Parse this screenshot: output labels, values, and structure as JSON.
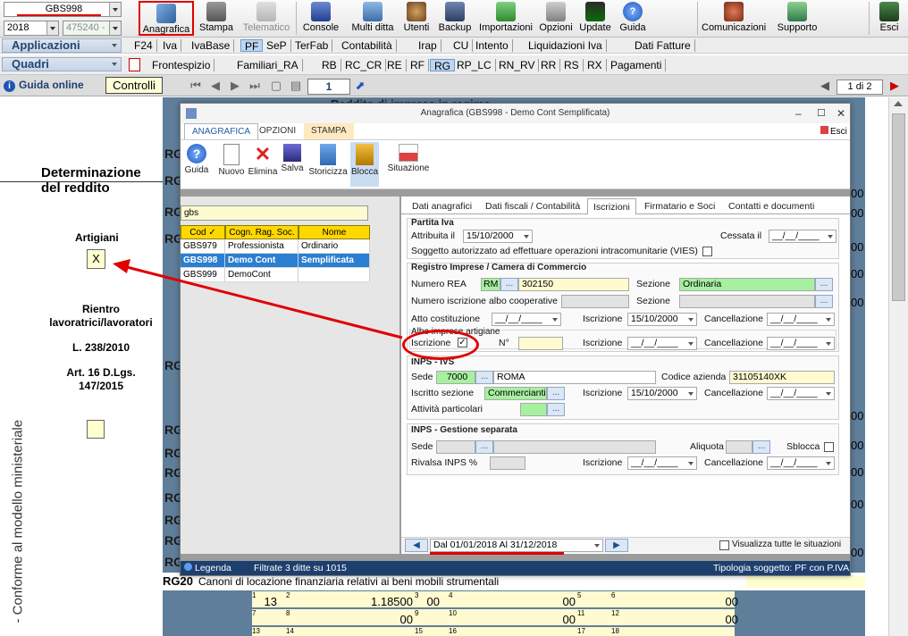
{
  "toolbar": {
    "company_code": "GBS998",
    "year": "2018",
    "company_number": "475240 -",
    "buttons": [
      {
        "label": "Anagrafica",
        "icon": "anagrafica-icon"
      },
      {
        "label": "Stampa",
        "icon": "printer-icon"
      },
      {
        "label": "Telematico",
        "icon": "telematico-icon"
      },
      {
        "label": "Console",
        "icon": "console-icon"
      },
      {
        "label": "Multi ditta",
        "icon": "multi-ditta-icon"
      },
      {
        "label": "Utenti",
        "icon": "users-icon"
      },
      {
        "label": "Backup",
        "icon": "backup-icon"
      },
      {
        "label": "Importazioni",
        "icon": "import-icon"
      },
      {
        "label": "Opzioni",
        "icon": "wrench-icon"
      },
      {
        "label": "Update",
        "icon": "update-icon"
      },
      {
        "label": "Guida",
        "icon": "help-icon"
      },
      {
        "label": "Comunicazioni",
        "icon": "comunicazioni-icon"
      },
      {
        "label": "Supporto",
        "icon": "supporto-icon"
      },
      {
        "label": "Esci",
        "icon": "exit-icon"
      }
    ]
  },
  "menu": {
    "applicazioni_label": "Applicazioni",
    "quadri_label": "Quadri",
    "applicazioni_items": [
      "F24",
      "Iva",
      "IvaBase",
      "PF",
      "SeP",
      "TerFab",
      "Contabilità",
      "Irap",
      "CU",
      "Intento",
      "Liquidazioni Iva",
      "Dati Fatture"
    ],
    "quadri_items": [
      "Frontespizio",
      "Familiari_RA",
      "RB",
      "RC_CR",
      "RE",
      "RF",
      "RG",
      "RP_LC",
      "RN_RV",
      "RR",
      "RS",
      "RX",
      "Pagamenti"
    ]
  },
  "nav": {
    "guida_online": "Guida online",
    "controlli": "Controlli",
    "page": "1",
    "page_of": "1 di 2"
  },
  "document": {
    "heading_partial": "Reddito di impresa in regime",
    "side_title_1": "Determinazione",
    "side_title_2": "del reddito",
    "artigiani": "Artigiani",
    "artigiani_mark": "X",
    "rientro_1": "Rientro",
    "rientro_2": "lavoratrici/lavoratori",
    "legge": "L. 238/2010",
    "art_1": "Art. 16 D.Lgs.",
    "art_2": "147/2015",
    "vertical_text": "- Conforme al modello ministeriale",
    "rg_label": "RG",
    "rg20_label": "RG20",
    "rg20_text": "Canoni di locazione finanziaria relativi ai beni mobili strumentali",
    "right_values": [
      "00",
      "00",
      "00",
      "00",
      "00",
      "00",
      "00",
      "00",
      "00",
      "00"
    ],
    "grid": {
      "row1": [
        {
          "n": "1",
          "v": "13"
        },
        {
          "n": "2",
          "v": "1.18500"
        },
        {
          "n": "3",
          "v": "00"
        },
        {
          "n": "4",
          "v": "00"
        },
        {
          "n": "5",
          "v": ""
        },
        {
          "n": "6",
          "v": "00"
        }
      ],
      "row2": [
        {
          "n": "7",
          "v": ""
        },
        {
          "n": "8",
          "v": "00"
        },
        {
          "n": "9",
          "v": ""
        },
        {
          "n": "10",
          "v": "00"
        },
        {
          "n": "11",
          "v": ""
        },
        {
          "n": "12",
          "v": "00"
        }
      ],
      "row3": [
        {
          "n": "13",
          "v": ""
        },
        {
          "n": "14",
          "v": ""
        },
        {
          "n": "15",
          "v": ""
        },
        {
          "n": "16",
          "v": ""
        },
        {
          "n": "17",
          "v": ""
        },
        {
          "n": "18",
          "v": ""
        }
      ]
    }
  },
  "dialog": {
    "title": "Anagrafica (GBS998 - Demo Cont Semplificata)",
    "esci": "Esci",
    "ribbon_tabs": [
      "ANAGRAFICA",
      "OPZIONI",
      "STAMPA"
    ],
    "ribbon_buttons": [
      "Guida",
      "Nuovo",
      "Elimina",
      "Salva",
      "Storicizza",
      "Blocca",
      "Situazione"
    ],
    "search_value": "gbs",
    "list": {
      "headers": [
        "Cod",
        "Cogn. Rag. Soc.",
        "Nome"
      ],
      "rows": [
        {
          "cod": "GBS979",
          "rag": "Professionista",
          "nome": "Ordinario"
        },
        {
          "cod": "GBS998",
          "rag": "Demo Cont",
          "nome": "Semplificata"
        },
        {
          "cod": "GBS999",
          "rag": "DemoCont",
          "nome": ""
        }
      ]
    },
    "panel_tabs": [
      "Dati anagrafici",
      "Dati fiscali / Contabilità",
      "Iscrizioni",
      "Firmatario e Soci",
      "Contatti e documenti"
    ],
    "partita_iva": {
      "title": "Partita Iva",
      "attribuita_label": "Attribuita il",
      "attribuita_value": "15/10/2000",
      "cessata_label": "Cessata il",
      "cessata_value": "__/__/____",
      "vies_label": "Soggetto autorizzato ad effettuare operazioni intracomunitarie (VIES)"
    },
    "registro": {
      "title": "Registro Imprese / Camera di Commercio",
      "numero_rea_label": "Numero REA",
      "rea_prov": "RM",
      "rea_value": "302150",
      "sezione_label": "Sezione",
      "sezione_value": "Ordinaria",
      "albo_coop_label": "Numero iscrizione albo cooperative",
      "sezione2_label": "Sezione",
      "atto_label": "Atto costituzione",
      "atto_value": "__/__/____",
      "iscrizione_label": "Iscrizione",
      "iscrizione_value": "15/10/2000",
      "cancellazione_label": "Cancellazione",
      "cancellazione_value": "__/__/____"
    },
    "albo": {
      "title": "Albo imprese artigiane",
      "iscrizione_label": "Iscrizione",
      "iscrizione_check": "✓",
      "numero_label": "N°",
      "iscrizione2_label": "Iscrizione",
      "iscrizione2_value": "__/__/____",
      "cancellazione_label": "Cancellazione",
      "cancellazione_value": "__/__/____"
    },
    "inps": {
      "title": "INPS - IVS",
      "sede_label": "Sede",
      "sede_code": "7000",
      "sede_name": "ROMA",
      "codice_label": "Codice azienda",
      "codice_value": "31105140XK",
      "sezione_label": "Iscritto sezione",
      "sezione_value": "Commercianti",
      "iscrizione_label": "Iscrizione",
      "iscrizione_value": "15/10/2000",
      "cancellazione_label": "Cancellazione",
      "cancellazione_value": "__/__/____",
      "attivita_label": "Attività particolari"
    },
    "gestione": {
      "title": "INPS - Gestione separata",
      "sede_label": "Sede",
      "aliquota_label": "Aliquota",
      "sblocca_label": "Sblocca",
      "rivalsa_label": "Rivalsa INPS %",
      "iscrizione_label": "Iscrizione",
      "iscrizione_value": "__/__/____",
      "cancellazione_label": "Cancellazione",
      "cancellazione_value": "__/__/____"
    },
    "period": "Dal 01/01/2018 Al 31/12/2018",
    "visualizza_label": "Visualizza tutte le situazioni",
    "footer": {
      "legenda": "Legenda",
      "filtrate": "Filtrate 3 ditte su 1015",
      "tipologia": "Tipologia soggetto: PF con P.IVA"
    }
  },
  "colors": {
    "accent_red": "#e00000",
    "selected_blue": "#2a7fd0",
    "header_yellow": "#ffd800",
    "footer_navy": "#1c3f6e",
    "field_green": "#a6f0a0"
  }
}
